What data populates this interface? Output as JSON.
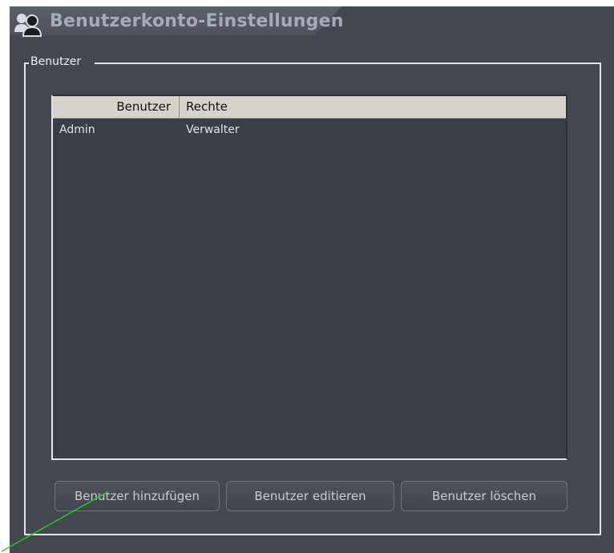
{
  "header": {
    "title": "Benutzerkonto-Einstellungen",
    "icon": "users-icon"
  },
  "group": {
    "legend": "Benutzer"
  },
  "table": {
    "columns": [
      "Benutzer",
      "Rechte"
    ],
    "rows": [
      {
        "user": "Admin",
        "rights": "Verwalter"
      }
    ]
  },
  "buttons": {
    "add": "Benutzer hinzufügen",
    "edit": "Benutzer editieren",
    "delete": "Benutzer löschen"
  },
  "colors": {
    "panel_background": "#434750",
    "title_text": "#a6abbc",
    "table_header": "#d6d3cc",
    "annotation_arrow": "#22cc22"
  }
}
